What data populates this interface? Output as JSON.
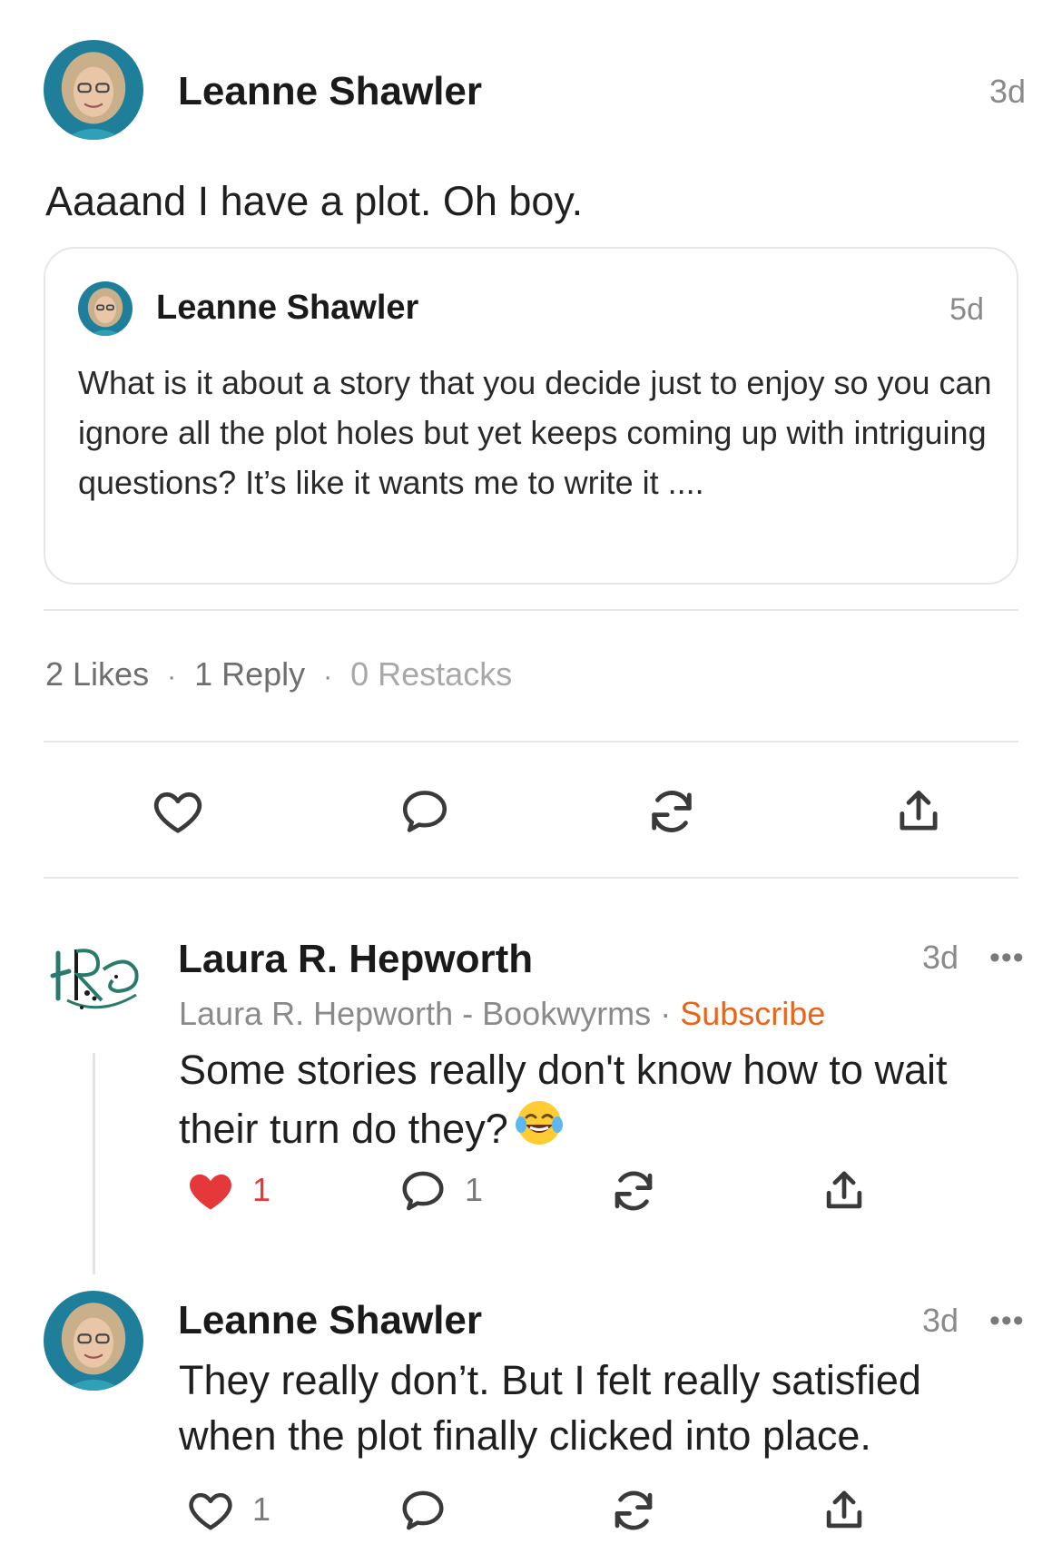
{
  "post": {
    "author": "Leanne Shawler",
    "time": "3d",
    "body": "Aaaand I have a plot. Oh boy.",
    "quote": {
      "author": "Leanne Shawler",
      "time": "5d",
      "body": "What is it about a story that you decide just to enjoy so you can ignore all the plot holes but yet keeps coming up with intriguing questions? It’s like it wants me to write it ...."
    },
    "stats": {
      "likes": "2 Likes",
      "sep": "·",
      "replies": "1 Reply",
      "restacks": "0 Restacks"
    }
  },
  "comments": [
    {
      "author": "Laura R. Hepworth",
      "time": "3d",
      "publication": "Laura R. Hepworth - Bookwyrms",
      "subscribe_sep": "·",
      "subscribe_label": "Subscribe",
      "body": "Some stories really don't know how to wait their turn do they?",
      "emoji": "face-with-tears-of-joy",
      "like_count": "1",
      "liked": true,
      "reply_count": "1",
      "more": "•••"
    },
    {
      "author": "Leanne Shawler",
      "time": "3d",
      "body": "They really don’t. But I felt really satisfied when the plot finally clicked into place.",
      "like_count": "1",
      "liked": false,
      "more": "•••"
    }
  ],
  "colors": {
    "accent_orange": "#e8641b",
    "like_red": "#e5383b",
    "avatar_bg": "#1f7f9a",
    "logo_teal": "#2a7a6c"
  },
  "icons": [
    "heart-icon",
    "comment-icon",
    "restack-icon",
    "share-icon",
    "more-icon"
  ]
}
